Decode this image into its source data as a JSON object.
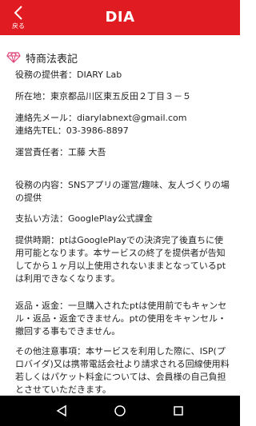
{
  "header": {
    "title": "DIA",
    "back_label": "戻る"
  },
  "section": {
    "title": "特商法表記"
  },
  "items": [
    {
      "text": "役務の提供者：DIARY Lab"
    },
    {
      "text": "所在地：東京都品川区東五反田２丁目３－５"
    },
    {
      "text": "連絡先メール：diarylabnext@gmail.com"
    },
    {
      "text": "連絡先TEL：03-3986-8897"
    },
    {
      "text": "運営責任者：工藤 大吾"
    },
    {
      "text": "役務の内容：SNSアプリの運営/趣味、友人づくりの場の提供"
    },
    {
      "text": "支払い方法：GooglePlay公式課金"
    },
    {
      "text": "提供時期：ptはGooglePlayでの決済完了後直ちに使用可能となります。本サービスの終了を提供者が告知してから１ヶ月以上使用されないままとなっているptは利用できなくなります。"
    },
    {
      "text": "返品・返金：一旦購入されたptは使用前でもキャンセル・返品・返金できません。ptの使用をキャンセル・撤回する事もできません。"
    },
    {
      "text": "その他注意事項：本サービスを利用した際に、ISP(プロバイダ)又は携帯電話会社より請求される回線使用料若しくはパケット料金については、会員様の自己負担とさせていただきます。"
    }
  ],
  "colors": {
    "header_bg": "#e11b22",
    "icon_accent": "#e0457b"
  },
  "navbar": {
    "icons": [
      "back-triangle-icon",
      "home-circle-icon",
      "recents-square-icon"
    ]
  }
}
